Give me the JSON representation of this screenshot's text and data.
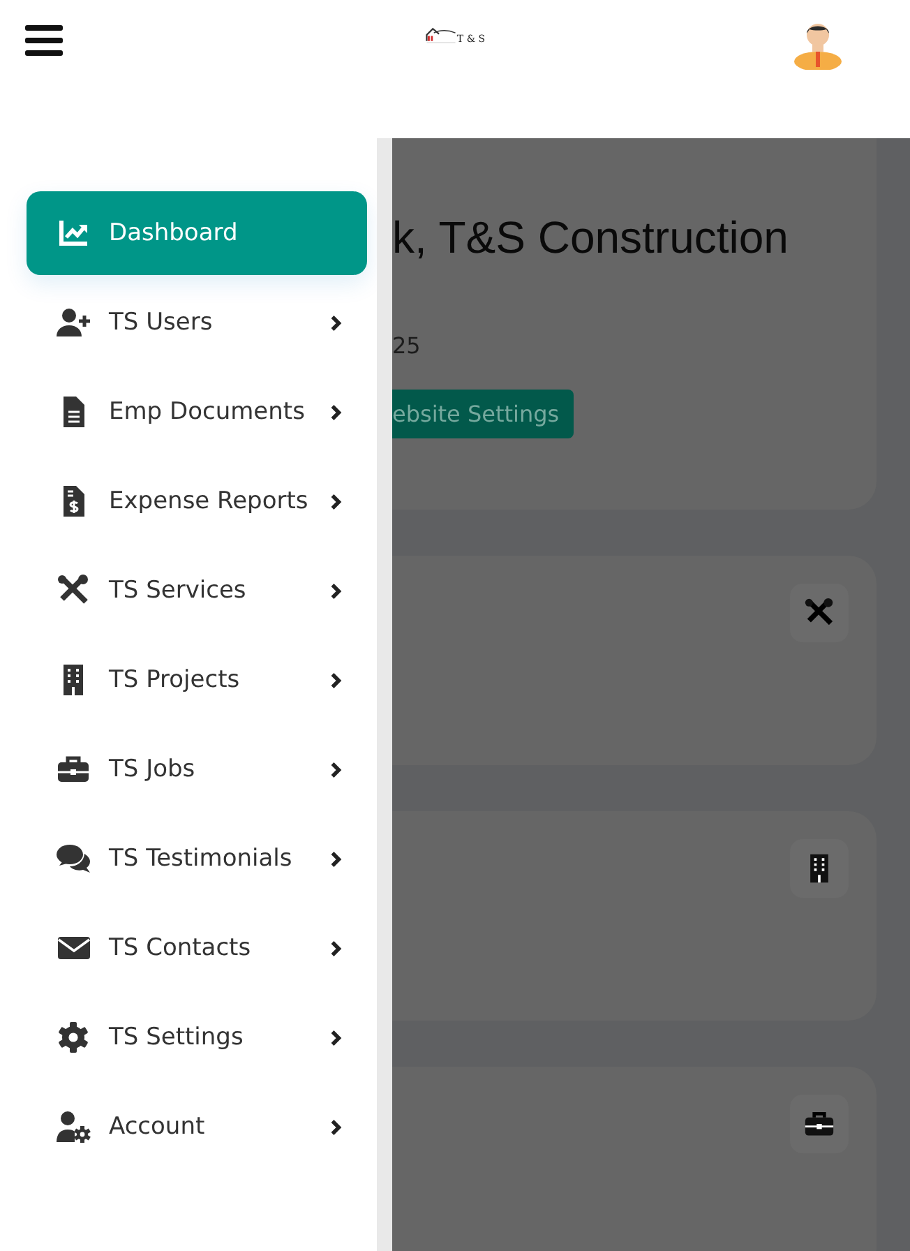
{
  "header": {
    "logo_text": "T & S"
  },
  "sidebar": {
    "items": [
      {
        "label": "Dashboard",
        "kind": "chart",
        "selected": true,
        "has_submenu": false
      },
      {
        "label": "TS Users",
        "kind": "user-plus",
        "selected": false,
        "has_submenu": true
      },
      {
        "label": "Emp Documents",
        "kind": "file",
        "selected": false,
        "has_submenu": true
      },
      {
        "label": "Expense Reports",
        "kind": "receipt",
        "selected": false,
        "has_submenu": true
      },
      {
        "label": "TS Services",
        "kind": "tools",
        "selected": false,
        "has_submenu": true
      },
      {
        "label": "TS Projects",
        "kind": "building",
        "selected": false,
        "has_submenu": true
      },
      {
        "label": "TS Jobs",
        "kind": "briefcase",
        "selected": false,
        "has_submenu": true
      },
      {
        "label": "TS Testimonials",
        "kind": "comments",
        "selected": false,
        "has_submenu": true
      },
      {
        "label": "TS Contacts",
        "kind": "envelope",
        "selected": false,
        "has_submenu": true
      },
      {
        "label": "TS Settings",
        "kind": "gear",
        "selected": false,
        "has_submenu": true
      },
      {
        "label": "Account",
        "kind": "user-gear",
        "selected": false,
        "has_submenu": true
      }
    ]
  },
  "welcome": {
    "heading": "k, T&S Construction",
    "date": "25",
    "button": "ebsite Settings"
  },
  "cards": [
    {
      "kind": "tools"
    },
    {
      "kind": "building"
    },
    {
      "kind": "briefcase"
    }
  ]
}
